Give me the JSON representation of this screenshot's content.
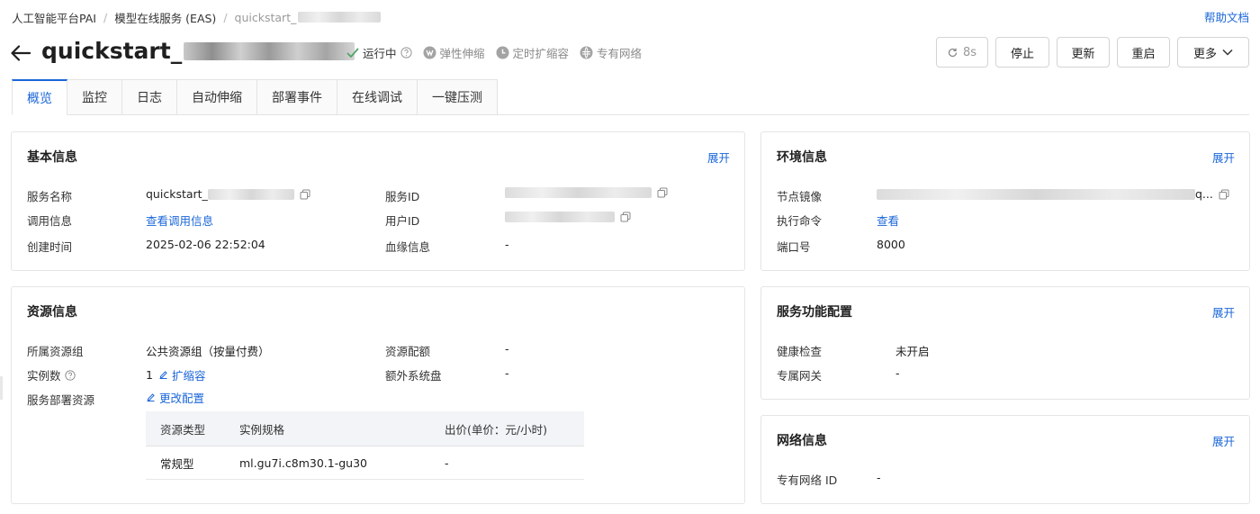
{
  "breadcrumb": {
    "items": [
      "人工智能平台PAI",
      "模型在线服务 (EAS)",
      "quickstart_"
    ],
    "separator": "/"
  },
  "help_link": "帮助文档",
  "title": {
    "prefix": "quickstart_",
    "middle": "_"
  },
  "status": {
    "running": "运行中",
    "elastic": "弹性伸缩",
    "scheduled": "定时扩缩容",
    "vpc": "专有网络"
  },
  "actions": {
    "refresh_label": "8s",
    "stop": "停止",
    "update": "更新",
    "restart": "重启",
    "more": "更多"
  },
  "tabs": [
    "概览",
    "监控",
    "日志",
    "自动伸缩",
    "部署事件",
    "在线调试",
    "一键压测"
  ],
  "basic_info": {
    "title": "基本信息",
    "expand": "展开",
    "service_name_label": "服务名称",
    "service_name_value": "quickstart_",
    "invoke_label": "调用信息",
    "invoke_value": "查看调用信息",
    "created_label": "创建时间",
    "created_value": "2025-02-06 22:52:04",
    "service_id_label": "服务ID",
    "user_id_label": "用户ID",
    "lineage_label": "血缘信息",
    "lineage_value": "-"
  },
  "env_info": {
    "title": "环境信息",
    "expand": "展开",
    "image_label": "节点镜像",
    "image_suffix": "q...",
    "command_label": "执行命令",
    "command_value": "查看",
    "port_label": "端口号",
    "port_value": "8000"
  },
  "resource_info": {
    "title": "资源信息",
    "group_label": "所属资源组",
    "group_value": "公共资源组（按量付费）",
    "instances_label": "实例数",
    "instances_value": "1",
    "scale_link": "扩缩容",
    "deploy_label": "服务部署资源",
    "change_link": "更改配置",
    "quota_label": "资源配额",
    "quota_value": "-",
    "disk_label": "额外系统盘",
    "disk_value": "-",
    "table": {
      "headers": [
        "资源类型",
        "实例规格",
        "出价(单价：元/小时)"
      ],
      "rows": [
        [
          "常规型",
          "ml.gu7i.c8m30.1-gu30",
          "-"
        ]
      ]
    }
  },
  "service_config": {
    "title": "服务功能配置",
    "expand": "展开",
    "health_label": "健康检查",
    "health_value": "未开启",
    "gateway_label": "专属网关",
    "gateway_value": "-"
  },
  "network_info": {
    "title": "网络信息",
    "expand": "展开",
    "vpc_label": "专有网络 ID",
    "vpc_value": "-"
  },
  "colors": {
    "accent": "#1a66d9",
    "success": "#52a36b",
    "border": "#e5e5e5"
  }
}
